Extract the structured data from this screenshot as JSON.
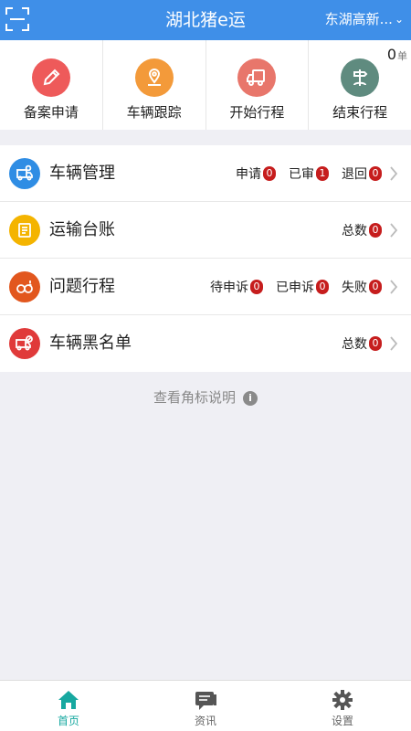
{
  "header": {
    "title": "湖北猪e运",
    "region": "东湖高新...",
    "scan_icon": "scan-icon",
    "chevron_icon": "chevron-down-icon"
  },
  "quick_actions": [
    {
      "label": "备案申请",
      "icon": "pencil-icon",
      "color": "#ee5a5a"
    },
    {
      "label": "车辆跟踪",
      "icon": "location-pin-icon",
      "color": "#f39a3a"
    },
    {
      "label": "开始行程",
      "icon": "truck-icon",
      "color": "#e8766b"
    },
    {
      "label": "结束行程",
      "icon": "signpost-icon",
      "color": "#5f8b7f"
    }
  ],
  "trip_count": {
    "value": "0",
    "unit": "单"
  },
  "rows": [
    {
      "label": "车辆管理",
      "icon": "truck-gear-icon",
      "color": "#2f8de4",
      "stats": [
        {
          "label": "申请",
          "value": "0"
        },
        {
          "label": "已审",
          "value": "1"
        },
        {
          "label": "退回",
          "value": "0"
        }
      ]
    },
    {
      "label": "运输台账",
      "icon": "ledger-icon",
      "color": "#f4b400",
      "stats": [
        {
          "label": "总数",
          "value": "0"
        }
      ]
    },
    {
      "label": "问题行程",
      "icon": "problem-trip-icon",
      "color": "#e2571e",
      "stats": [
        {
          "label": "待申诉",
          "value": "0"
        },
        {
          "label": "已申诉",
          "value": "0"
        },
        {
          "label": "失败",
          "value": "0"
        }
      ]
    },
    {
      "label": "车辆黑名单",
      "icon": "blocked-truck-icon",
      "color": "#e03a3a",
      "stats": [
        {
          "label": "总数",
          "value": "0"
        }
      ]
    }
  ],
  "hint": {
    "text": "查看角标说明",
    "icon": "info-icon"
  },
  "tabbar": [
    {
      "label": "首页",
      "icon": "home-icon",
      "active": true
    },
    {
      "label": "资讯",
      "icon": "news-icon",
      "active": false
    },
    {
      "label": "设置",
      "icon": "gear-icon",
      "active": false
    }
  ],
  "accent_colors": {
    "header": "#3f8fe8",
    "active_tab": "#17a8a0",
    "badge": "#c61d1d"
  }
}
